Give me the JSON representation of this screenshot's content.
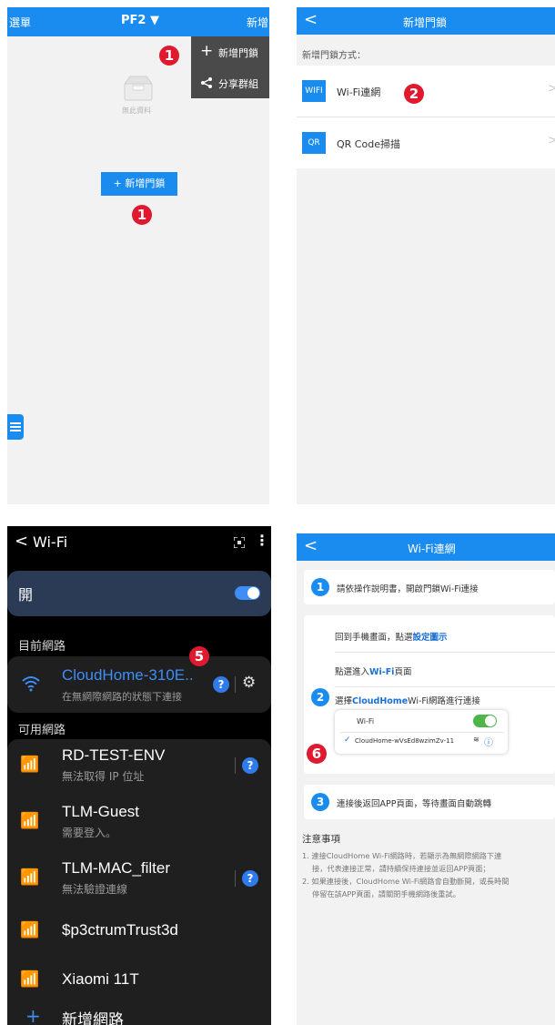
{
  "p1": {
    "menu_label": "選單",
    "title": "PF2 ▼",
    "add_label": "新增",
    "dropdown": {
      "add_lock": "新增門鎖",
      "share_group": "分享群組"
    },
    "empty_text": "無此資料",
    "add_lock_button": "+ 新增門鎖",
    "badge_top": "1",
    "badge_bottom": "1"
  },
  "p2": {
    "title": "新增門鎖",
    "section_label": "新增門鎖方式：",
    "options": [
      {
        "icon_text": "WIFI",
        "label": "Wi-Fi連網"
      },
      {
        "icon_text": "QR",
        "label": "QR Code掃描"
      }
    ],
    "badge": "2"
  },
  "p3": {
    "title": "Wi-Fi",
    "toggle_label": "開",
    "current_header": "目前網路",
    "current": {
      "name": "CloudHome-310E..",
      "status": "在無網際網路的狀態下連接"
    },
    "available_header": "可用網路",
    "networks": [
      {
        "name": "RD-TEST-ENV",
        "sub": "無法取得 IP 位址"
      },
      {
        "name": "TLM-Guest",
        "sub": "需要登入。"
      },
      {
        "name": "TLM-MAC_filter",
        "sub": "無法驗證連線"
      },
      {
        "name": "$p3ctrumTrust3d",
        "sub": ""
      },
      {
        "name": "Xiaomi 11T",
        "sub": ""
      }
    ],
    "add_network": "新增網路",
    "badge": "5"
  },
  "p4": {
    "title": "Wi-Fi連網",
    "step1": "請依操作說明書，開啟門鎖Wi-Fi連接",
    "step2_line1_pre": "回到手機畫面，點選",
    "step2_line1_link": "設定圖示",
    "step2_line2_pre": "點選進入",
    "step2_line2_link": "Wi-Fi",
    "step2_line2_post": "頁面",
    "step2_line3_pre": "選擇",
    "step2_line3_link": "CloudHome",
    "step2_line3_post": "Wi-Fi網路進行連接",
    "mini_wifi_label": "Wi-Fi",
    "mini_network": "CloudHome-wVsEd8wzimZv-11",
    "step3": "連接後返回APP頁面，等待畫面自動跳轉",
    "notes_title": "注意事項",
    "note1_l1": "1. 連接CloudHome Wi-Fi網路時，若顯示為無網際網路下連",
    "note1_l2": "接，代表連接正常，請持續保持連接並返回APP頁面；",
    "note2_l1": "2. 如果連接後，CloudHome Wi-Fi網路會自動斷開，或長時間",
    "note2_l2": "停留在該APP頁面，請關閉手機網路後重試。",
    "step_numbers": [
      "1",
      "2",
      "3"
    ],
    "badge": "6"
  }
}
